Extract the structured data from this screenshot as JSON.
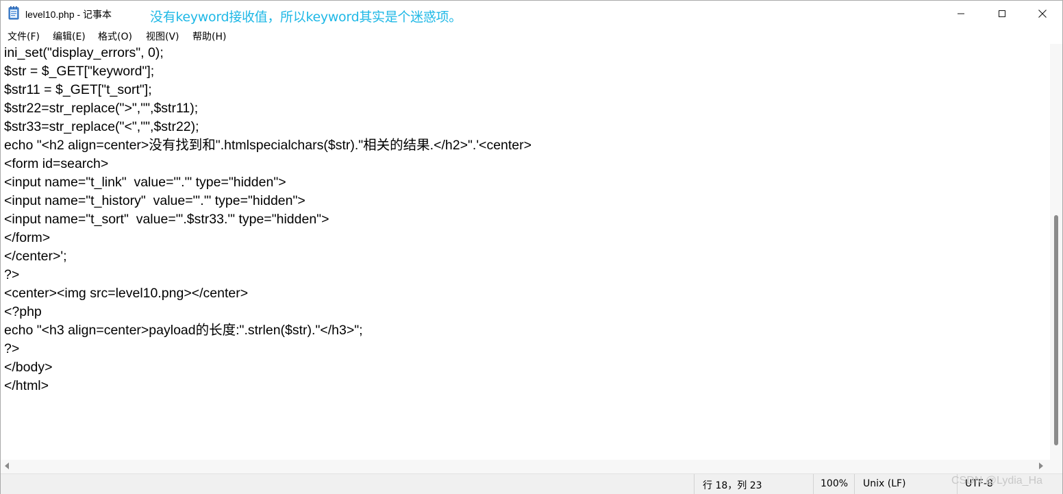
{
  "window": {
    "title": "level10.php - 记事本",
    "annotation": "没有keyword接收值，所以keyword其实是个迷惑项。"
  },
  "menu": {
    "items": [
      "文件(F)",
      "编辑(E)",
      "格式(O)",
      "视图(V)",
      "帮助(H)"
    ]
  },
  "editor": {
    "lines": [
      "ini_set(\"display_errors\", 0);",
      "$str = $_GET[\"keyword\"];",
      "$str11 = $_GET[\"t_sort\"];",
      "$str22=str_replace(\">\",\"\",$str11);",
      "$str33=str_replace(\"<\",\"\",$str22);",
      "echo \"<h2 align=center>没有找到和\".htmlspecialchars($str).\"相关的结果.</h2>\".'<center>",
      "<form id=search>",
      "<input name=\"t_link\"  value=\"'.'\" type=\"hidden\">",
      "<input name=\"t_history\"  value=\"'.'\" type=\"hidden\">",
      "<input name=\"t_sort\"  value=\"'.$str33.'\" type=\"hidden\">",
      "</form>",
      "</center>';",
      "?>",
      "<center><img src=level10.png></center>",
      "<?php",
      "echo \"<h3 align=center>payload的长度:\".strlen($str).\"</h3>\";",
      "?>",
      "</body>",
      "</html>"
    ]
  },
  "statusbar": {
    "position": "行 18，列 23",
    "zoom": "100%",
    "line_ending": "Unix (LF)",
    "encoding": "UTF-8"
  },
  "watermark": "CSDN @Lydia_Ha",
  "colors": {
    "annotation": "#1fb8e6",
    "statusbar_bg": "#f0f0f0"
  },
  "icons": [
    "notepad-icon",
    "minimize-icon",
    "maximize-icon",
    "close-icon",
    "scroll-left-icon",
    "scroll-right-icon"
  ]
}
